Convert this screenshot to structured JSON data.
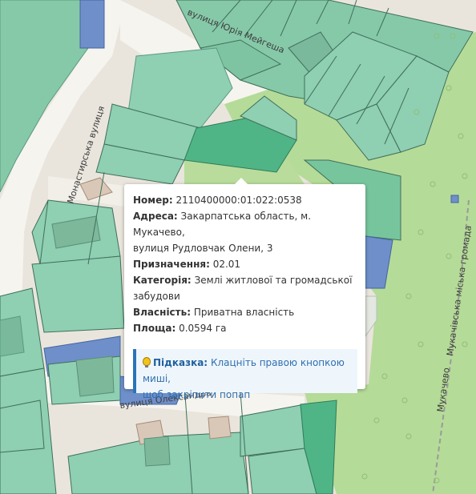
{
  "map": {
    "streets": {
      "monastyrska": "Монастирська вулиця",
      "meiheshа": "вулиця Юрія Мейгеша",
      "oleksandra": "вулиця Олександра",
      "mukachivska_rail": "Мукачівська міська громада",
      "mukachevo_rail": "Мукачево"
    }
  },
  "popup": {
    "number": {
      "label": "Номер:",
      "value": "2110400000:01:022:0538"
    },
    "address": {
      "label": "Адреса:",
      "value_line1": "Закарпатська область, м. Мукачево,",
      "value_line2": "вулиця Рудловчак Олени, 3"
    },
    "purpose": {
      "label": "Призначення:",
      "value": "02.01"
    },
    "category": {
      "label": "Категорія:",
      "value_line1": "Землі житлової та громадської",
      "value_line2": "забудови"
    },
    "ownership": {
      "label": "Власність:",
      "value": "Приватна власність"
    },
    "area": {
      "label": "Площа:",
      "value": "0.0594 га"
    },
    "hint": {
      "icon": "lightbulb-icon",
      "label": "Підказка:",
      "text_line1": "Клацніть правою кнопкою миші,",
      "text_line2": "щоб закріпити попап"
    }
  },
  "colors": {
    "parcel": "#8fcfb2",
    "parcel_selected": "#4fb586",
    "parcel_state": "#6f8fca",
    "park": "#b6dc9a",
    "road": "#f6f4f0"
  }
}
